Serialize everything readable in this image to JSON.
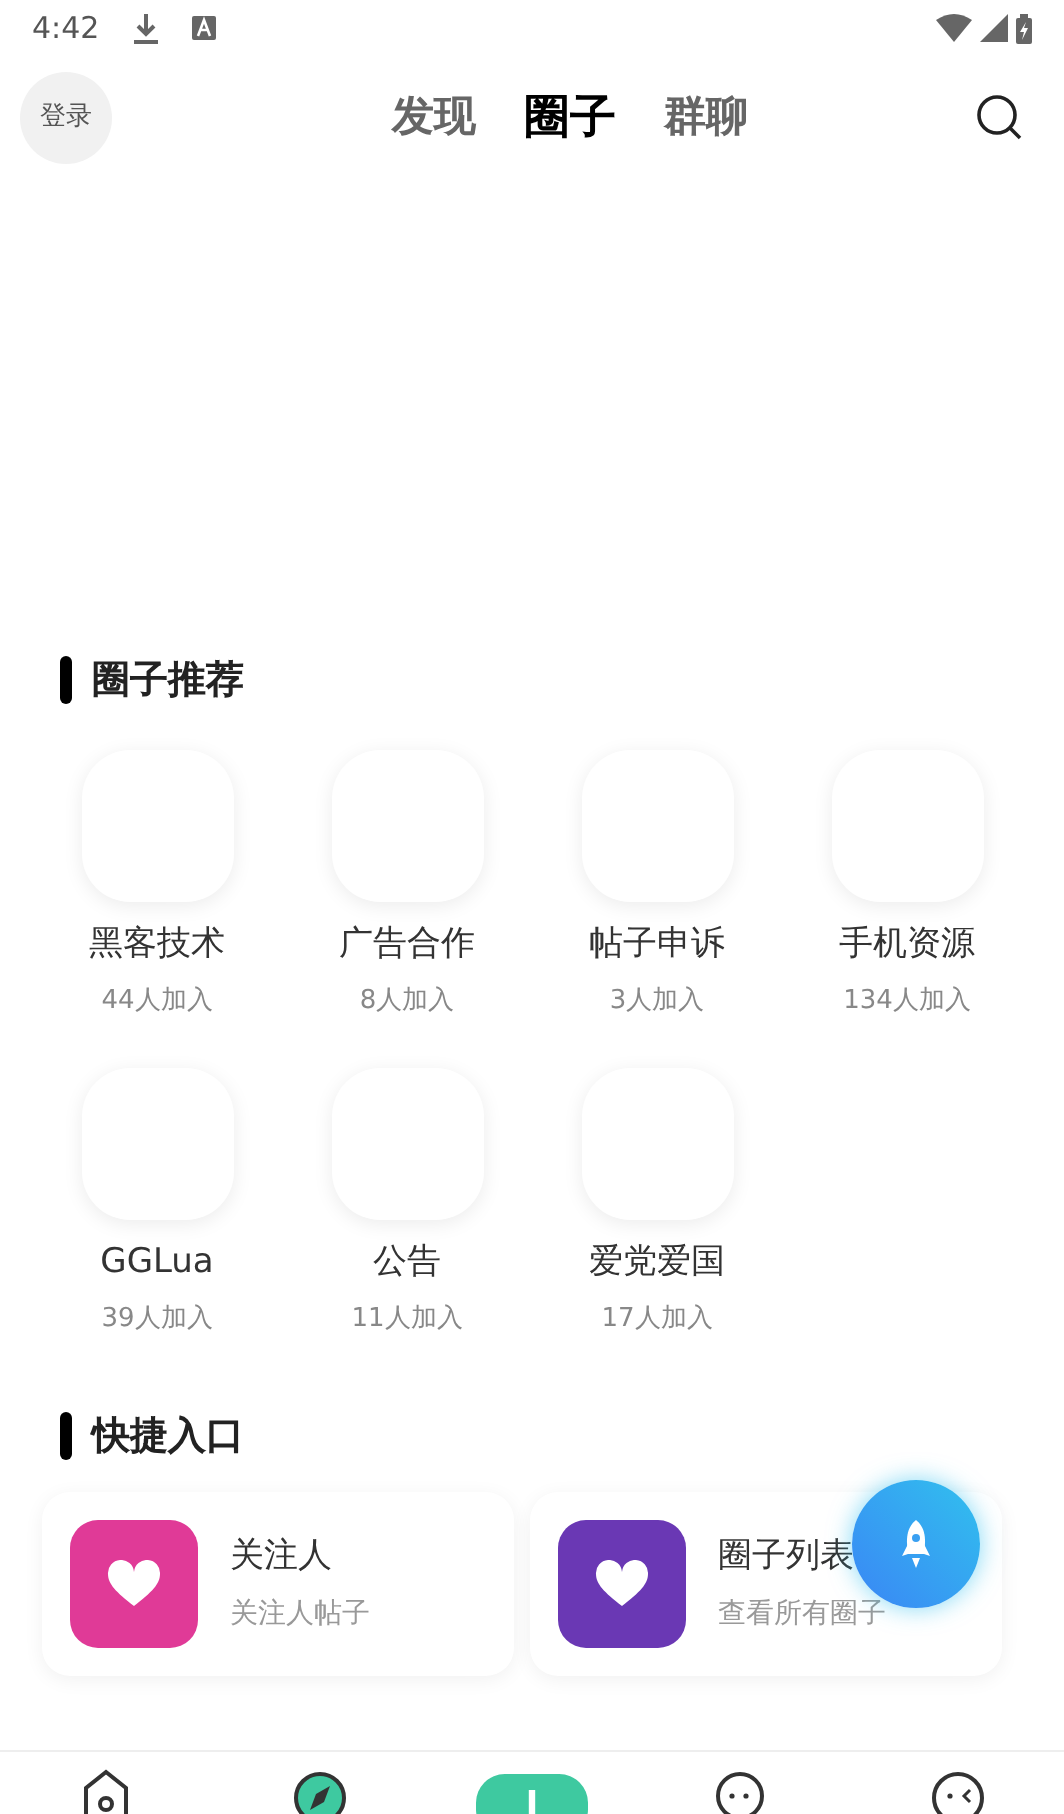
{
  "status_bar": {
    "time": "4:42"
  },
  "header": {
    "login": "登录",
    "tabs": [
      {
        "label": "发现",
        "selected": false
      },
      {
        "label": "圈子",
        "selected": true
      },
      {
        "label": "群聊",
        "selected": false
      }
    ]
  },
  "recommend": {
    "title": "圈子推荐",
    "circles": [
      {
        "name": "黑客技术",
        "count": "44人加入"
      },
      {
        "name": "广告合作",
        "count": "8人加入"
      },
      {
        "name": "帖子申诉",
        "count": "3人加入"
      },
      {
        "name": "手机资源",
        "count": "134人加入"
      },
      {
        "name": "GGLua",
        "count": "39人加入"
      },
      {
        "name": "公告",
        "count": "11人加入"
      },
      {
        "name": "爱党爱国",
        "count": "17人加入"
      }
    ]
  },
  "quick": {
    "title": "快捷入口",
    "entries": [
      {
        "title": "关注人",
        "subtitle": "关注人帖子",
        "color": "#e03a97"
      },
      {
        "title": "圈子列表",
        "subtitle": "查看所有圈子",
        "color": "#6a38b4"
      }
    ]
  },
  "bottom_nav": [
    {
      "kind": "home"
    },
    {
      "kind": "compass"
    },
    {
      "kind": "post"
    },
    {
      "kind": "chat"
    },
    {
      "kind": "face"
    }
  ]
}
